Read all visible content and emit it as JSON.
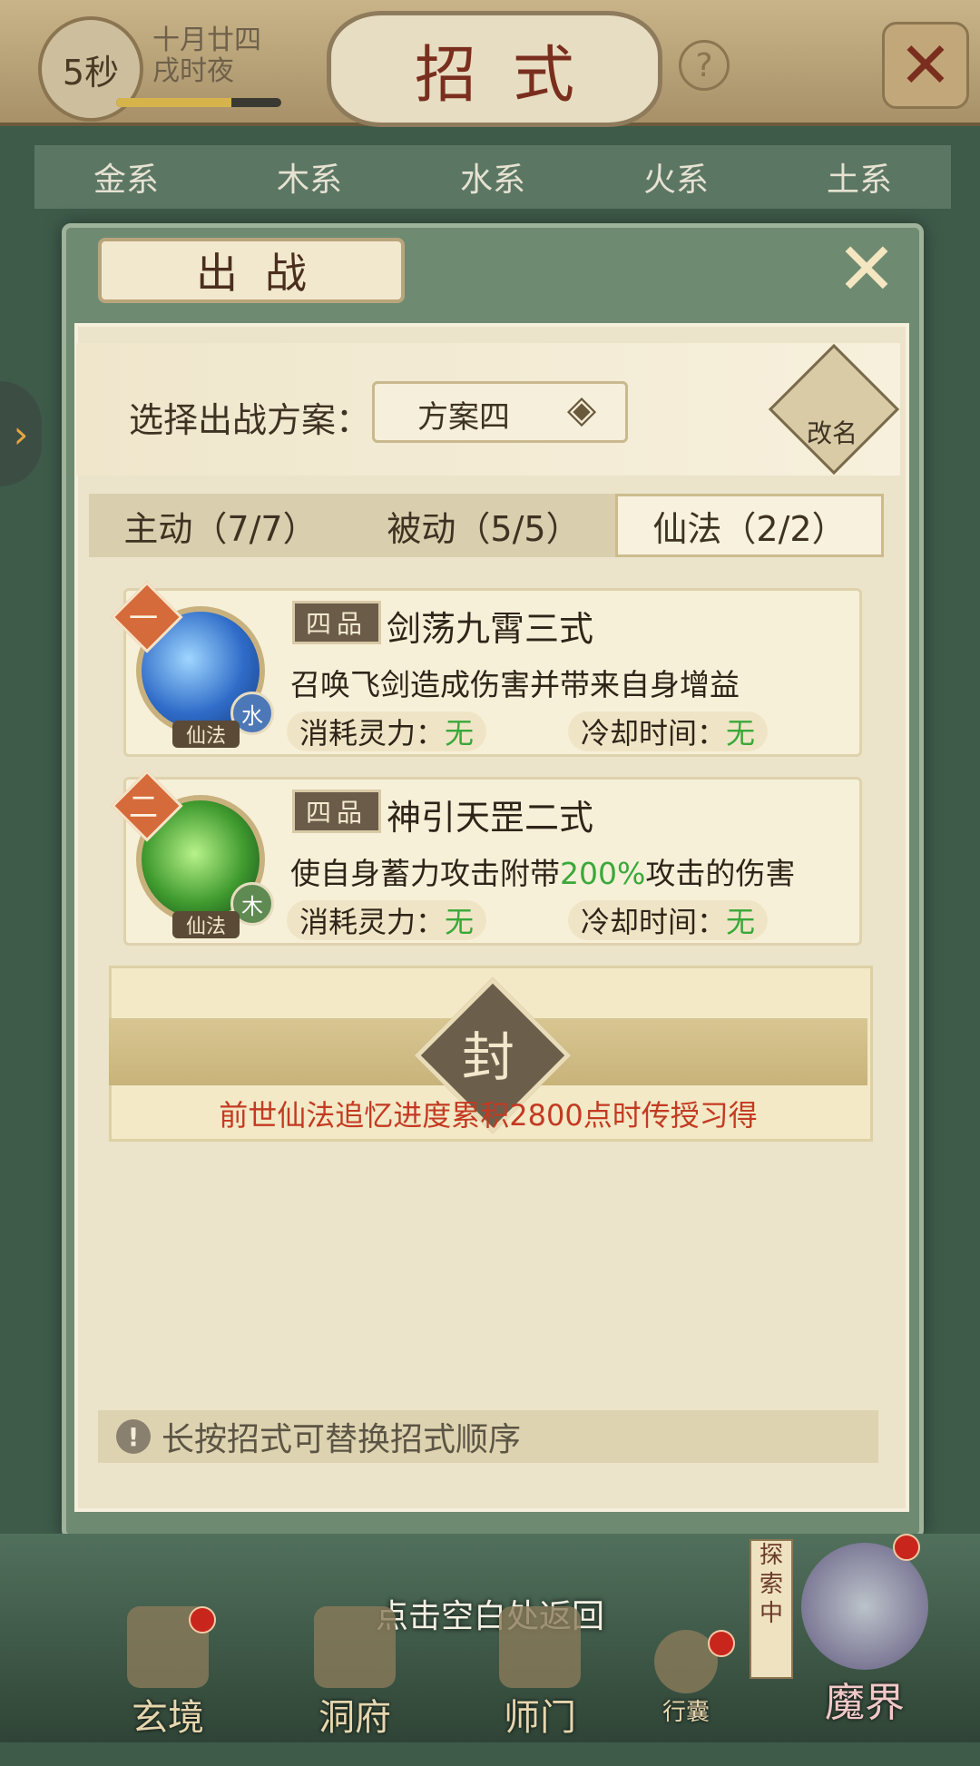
{
  "header": {
    "timer": "5秒",
    "date_line1": "十月廿四",
    "date_line2": "戌时夜",
    "time_progress": 0.7,
    "title": "招式",
    "help_icon": "question-icon",
    "close_icon": "close-icon"
  },
  "element_tabs": [
    "金系",
    "木系",
    "水系",
    "火系",
    "土系"
  ],
  "dialog": {
    "title": "出战",
    "scheme_label": "选择出战方案：",
    "scheme_value": "方案四",
    "rename_label": "改名",
    "tabs": [
      "主动（7/7）",
      "被动（5/5）",
      "仙法（2/2）"
    ],
    "active_tab": 2,
    "skills": [
      {
        "rank": "一",
        "type": "仙法",
        "element": "水",
        "element_color": "#4d78b8",
        "grade": "四品",
        "name": "剑荡九霄三式",
        "desc": "召唤飞剑造成伤害并带来自身增益",
        "cost_label": "消耗灵力：",
        "cost_value": "无",
        "cd_label": "冷却时间：",
        "cd_value": "无"
      },
      {
        "rank": "二",
        "type": "仙法",
        "element": "木",
        "element_color": "#5f8a52",
        "grade": "四品",
        "name": "神引天罡二式",
        "desc_pre": "使自身蓄力攻击附带",
        "desc_hl": "200%",
        "desc_post": "攻击的伤害",
        "cost_label": "消耗灵力：",
        "cost_value": "无",
        "cd_label": "冷却时间：",
        "cd_value": "无"
      }
    ],
    "sealed": {
      "seal_char": "封",
      "text": "前世仙法追忆进度累积2800点时传授习得"
    },
    "tip": "长按招式可替换招式顺序"
  },
  "footer": {
    "return_text": "点击空白处返回",
    "explore_label": "探索中",
    "nav": [
      "玄境",
      "洞府",
      "师门",
      "行囊",
      "魔界"
    ]
  }
}
